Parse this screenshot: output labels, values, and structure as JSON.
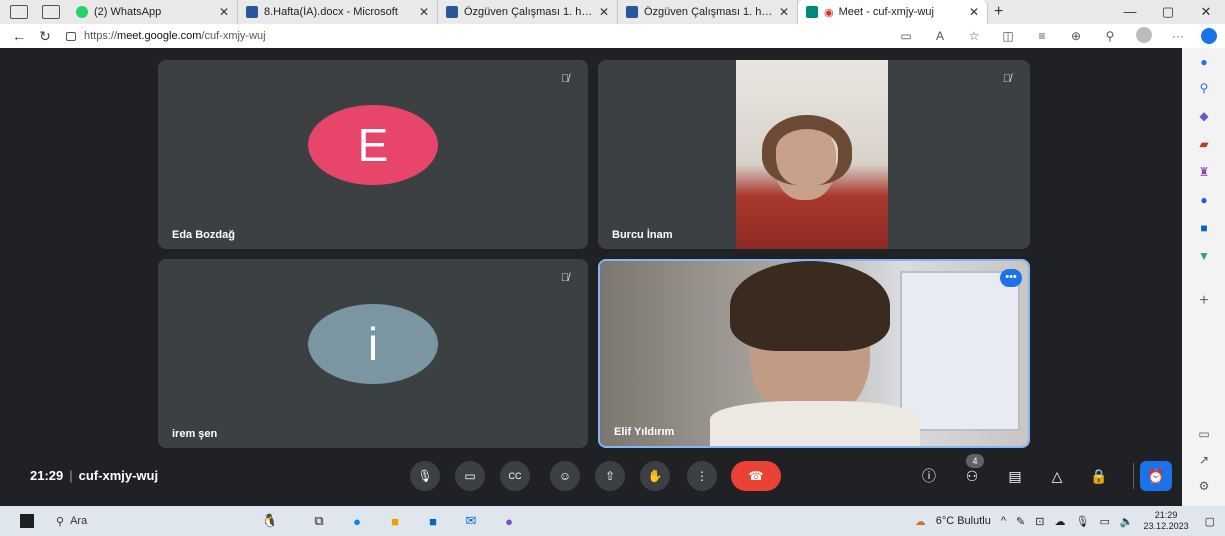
{
  "browser": {
    "tabs": [
      {
        "title": "(2) WhatsApp",
        "icon": "whatsapp-icon",
        "color": "#25d366"
      },
      {
        "title": "8.Hafta(İA).docx - Microsoft",
        "icon": "word-icon",
        "color": "#2b579a"
      },
      {
        "title": "Özgüven Çalışması 1. hafta",
        "icon": "word-icon",
        "color": "#2b579a"
      },
      {
        "title": "Özgüven Çalışması 1. hafta",
        "icon": "word-icon",
        "color": "#2b579a"
      },
      {
        "title": "Meet - cuf-xmjy-wuj",
        "icon": "meet-icon",
        "color": "#00897b",
        "active": true
      }
    ],
    "url_prefix": "https://",
    "url_host": "meet.google.com",
    "url_path": "/cuf-xmjy-wuj"
  },
  "meet": {
    "participants": [
      {
        "name": "Eda Bozdağ",
        "initial": "E",
        "avatar_color": "#e8456b",
        "muted": true
      },
      {
        "name": "Burcu İnam",
        "muted": true,
        "video": true
      },
      {
        "name": "irem şen",
        "initial": "i",
        "avatar_color": "#7b96a3",
        "muted": true
      },
      {
        "name": "Elif Yıldırım",
        "video": true,
        "active_speaker": true
      }
    ],
    "time": "21:29",
    "meeting_code": "cuf-xmjy-wuj",
    "people_count": "4",
    "accent": "#1a73e8",
    "end_call_color": "#ea4335"
  },
  "taskbar": {
    "search_label": "Ara",
    "weather": "6°C Bulutlu",
    "time": "21:29",
    "date": "23.12.2023"
  }
}
